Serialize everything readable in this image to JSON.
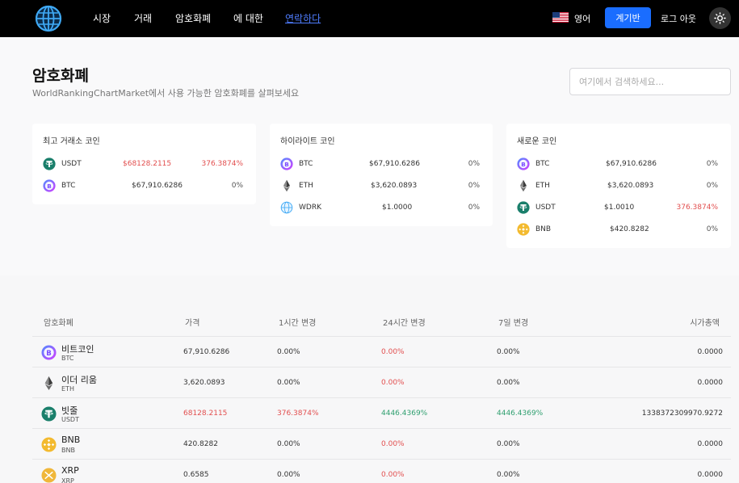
{
  "nav": {
    "links": [
      "시장",
      "거래",
      "암호화폐",
      "에 대한",
      "연락하다"
    ],
    "language": "영어",
    "dashboard_label": "계기반",
    "logout_label": "로그 아웃"
  },
  "header": {
    "title": "암호화폐",
    "subtitle": "WorldRankingChartMarket에서 사용 가능한 암호화폐를 살펴보세요",
    "search_placeholder": "여기에서 검색하세요..."
  },
  "cards": [
    {
      "title": "최고 거래소 코인",
      "rows": [
        {
          "icon": "usdt-icon",
          "symbol": "USDT",
          "price": "$68128.2115",
          "change": "376.3874%",
          "up": true
        },
        {
          "icon": "btc-icon",
          "symbol": "BTC",
          "price": "$67,910.6286",
          "change": "0%",
          "up": false
        }
      ]
    },
    {
      "title": "하이라이트 코인",
      "rows": [
        {
          "icon": "btc-icon",
          "symbol": "BTC",
          "price": "$67,910.6286",
          "change": "0%",
          "up": false
        },
        {
          "icon": "eth-icon",
          "symbol": "ETH",
          "price": "$3,620.0893",
          "change": "0%",
          "up": false
        },
        {
          "icon": "wdrk-icon",
          "symbol": "WDRK",
          "price": "$1.0000",
          "change": "0%",
          "up": false
        }
      ]
    },
    {
      "title": "새로운 코인",
      "rows": [
        {
          "icon": "btc-icon",
          "symbol": "BTC",
          "price": "$67,910.6286",
          "change": "0%",
          "up": false
        },
        {
          "icon": "eth-icon",
          "symbol": "ETH",
          "price": "$3,620.0893",
          "change": "0%",
          "up": false
        },
        {
          "icon": "usdt-icon",
          "symbol": "USDT",
          "price": "$1.0010",
          "change": "376.3874%",
          "up": true
        },
        {
          "icon": "bnb-icon",
          "symbol": "BNB",
          "price": "$420.8282",
          "change": "0%",
          "up": false
        }
      ]
    }
  ],
  "table": {
    "headers": [
      "암호화폐",
      "가격",
      "1시간 변경",
      "24시간 변경",
      "7일 변경",
      "시가총액"
    ],
    "rows": [
      {
        "icon": "btc-icon",
        "name": "비트코인",
        "symbol": "BTC",
        "price": "67,910.6286",
        "h1": "0.00%",
        "h24": "0.00%",
        "d7": "0.00%",
        "mcap": "0.0000",
        "h1_color": "",
        "h24_color": "red",
        "d7_color": "",
        "price_color": ""
      },
      {
        "icon": "eth-icon",
        "name": "이더 리움",
        "symbol": "ETH",
        "price": "3,620.0893",
        "h1": "0.00%",
        "h24": "0.00%",
        "d7": "0.00%",
        "mcap": "0.0000",
        "h1_color": "",
        "h24_color": "red",
        "d7_color": "",
        "price_color": ""
      },
      {
        "icon": "usdt-icon",
        "name": "빗줄",
        "symbol": "USDT",
        "price": "68128.2115",
        "h1": "376.3874%",
        "h24": "4446.4369%",
        "d7": "4446.4369%",
        "mcap": "1338372309970.9272",
        "h1_color": "red",
        "h24_color": "green",
        "d7_color": "green",
        "price_color": "red"
      },
      {
        "icon": "bnb-icon",
        "name": "BNB",
        "symbol": "BNB",
        "price": "420.8282",
        "h1": "0.00%",
        "h24": "0.00%",
        "d7": "0.00%",
        "mcap": "0.0000",
        "h1_color": "",
        "h24_color": "red",
        "d7_color": "",
        "price_color": ""
      },
      {
        "icon": "xrp-icon",
        "name": "XRP",
        "symbol": "XRP",
        "price": "0.6585",
        "h1": "0.00%",
        "h24": "0.00%",
        "d7": "0.00%",
        "mcap": "0.0000",
        "h1_color": "",
        "h24_color": "red",
        "d7_color": "",
        "price_color": ""
      }
    ]
  }
}
